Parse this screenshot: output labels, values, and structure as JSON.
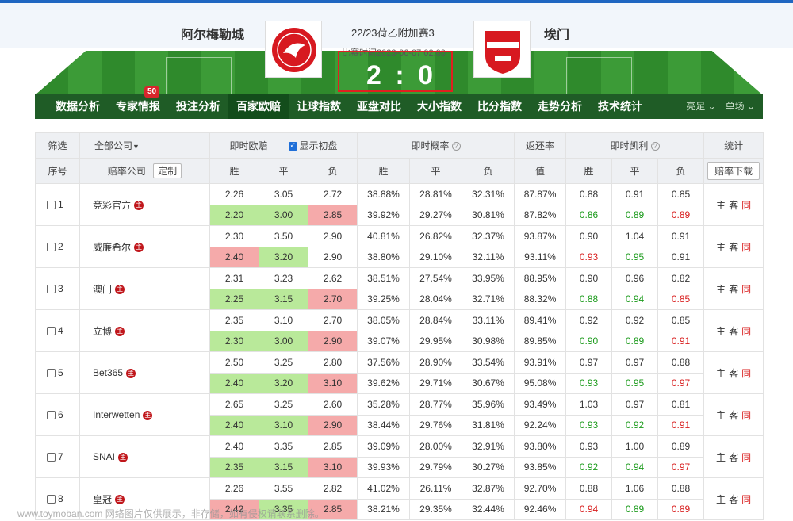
{
  "header": {
    "home_team": "阿尔梅勒城",
    "away_team": "埃门",
    "match_title": "22/23荷乙附加赛3",
    "match_time": "比赛时间2023-06-07 02:00",
    "score": "2 : 0"
  },
  "nav": {
    "items": [
      "数据分析",
      "专家情报",
      "投注分析",
      "百家欧赔",
      "让球指数",
      "亚盘对比",
      "大小指数",
      "比分指数",
      "走势分析",
      "技术统计"
    ],
    "badge": "50",
    "active_index": 3,
    "right_options": [
      "亮足 ⌄",
      "单场 ⌄"
    ]
  },
  "table_header": {
    "filter": "筛选",
    "all_companies": "全部公司",
    "live_euro": "即时欧赔",
    "show_initial": "显示初盘",
    "live_prob": "即时概率",
    "return_rate": "返还率",
    "live_kelly": "即时凯利",
    "stats": "统计",
    "seq": "序号",
    "company": "赔率公司",
    "customize": "定制",
    "win": "胜",
    "draw": "平",
    "lose": "负",
    "value": "值",
    "download": "赔率下载"
  },
  "stat_labels": {
    "home": "主",
    "away": "客",
    "same": "同"
  },
  "rows": [
    {
      "idx": "1",
      "name": "竞彩官方",
      "live": [
        "2.26",
        "3.05",
        "2.72"
      ],
      "init": [
        "2.20",
        "3.00",
        "2.85"
      ],
      "init_colors": [
        "g",
        "g",
        "r"
      ],
      "prob_live": [
        "38.88%",
        "28.81%",
        "32.31%"
      ],
      "prob_init": [
        "39.92%",
        "29.27%",
        "30.81%"
      ],
      "ret_live": "87.87%",
      "ret_init": "87.82%",
      "kelly_live": [
        "0.88",
        "0.91",
        "0.85"
      ],
      "kelly_init": [
        "0.86",
        "0.89",
        "0.89"
      ],
      "kelly_colors": [
        "g",
        "g",
        "r"
      ]
    },
    {
      "idx": "2",
      "name": "威廉希尔",
      "live": [
        "2.30",
        "3.50",
        "2.90"
      ],
      "init": [
        "2.40",
        "3.20",
        "2.90"
      ],
      "init_colors": [
        "r",
        "g",
        ""
      ],
      "prob_live": [
        "40.81%",
        "26.82%",
        "32.37%"
      ],
      "prob_init": [
        "38.80%",
        "29.10%",
        "32.11%"
      ],
      "ret_live": "93.87%",
      "ret_init": "93.11%",
      "kelly_live": [
        "0.90",
        "1.04",
        "0.91"
      ],
      "kelly_init": [
        "0.93",
        "0.95",
        "0.91"
      ],
      "kelly_colors": [
        "r",
        "g",
        ""
      ]
    },
    {
      "idx": "3",
      "name": "澳门",
      "live": [
        "2.31",
        "3.23",
        "2.62"
      ],
      "init": [
        "2.25",
        "3.15",
        "2.70"
      ],
      "init_colors": [
        "g",
        "g",
        "r"
      ],
      "prob_live": [
        "38.51%",
        "27.54%",
        "33.95%"
      ],
      "prob_init": [
        "39.25%",
        "28.04%",
        "32.71%"
      ],
      "ret_live": "88.95%",
      "ret_init": "88.32%",
      "kelly_live": [
        "0.90",
        "0.96",
        "0.82"
      ],
      "kelly_init": [
        "0.88",
        "0.94",
        "0.85"
      ],
      "kelly_colors": [
        "g",
        "g",
        "r"
      ]
    },
    {
      "idx": "4",
      "name": "立博",
      "live": [
        "2.35",
        "3.10",
        "2.70"
      ],
      "init": [
        "2.30",
        "3.00",
        "2.90"
      ],
      "init_colors": [
        "g",
        "g",
        "r"
      ],
      "prob_live": [
        "38.05%",
        "28.84%",
        "33.11%"
      ],
      "prob_init": [
        "39.07%",
        "29.95%",
        "30.98%"
      ],
      "ret_live": "89.41%",
      "ret_init": "89.85%",
      "kelly_live": [
        "0.92",
        "0.92",
        "0.85"
      ],
      "kelly_init": [
        "0.90",
        "0.89",
        "0.91"
      ],
      "kelly_colors": [
        "g",
        "g",
        "r"
      ]
    },
    {
      "idx": "5",
      "name": "Bet365",
      "live": [
        "2.50",
        "3.25",
        "2.80"
      ],
      "init": [
        "2.40",
        "3.20",
        "3.10"
      ],
      "init_colors": [
        "g",
        "g",
        "r"
      ],
      "prob_live": [
        "37.56%",
        "28.90%",
        "33.54%"
      ],
      "prob_init": [
        "39.62%",
        "29.71%",
        "30.67%"
      ],
      "ret_live": "93.91%",
      "ret_init": "95.08%",
      "kelly_live": [
        "0.97",
        "0.97",
        "0.88"
      ],
      "kelly_init": [
        "0.93",
        "0.95",
        "0.97"
      ],
      "kelly_colors": [
        "g",
        "g",
        "r"
      ]
    },
    {
      "idx": "6",
      "name": "Interwetten",
      "live": [
        "2.65",
        "3.25",
        "2.60"
      ],
      "init": [
        "2.40",
        "3.10",
        "2.90"
      ],
      "init_colors": [
        "g",
        "g",
        "r"
      ],
      "prob_live": [
        "35.28%",
        "28.77%",
        "35.96%"
      ],
      "prob_init": [
        "38.44%",
        "29.76%",
        "31.81%"
      ],
      "ret_live": "93.49%",
      "ret_init": "92.24%",
      "kelly_live": [
        "1.03",
        "0.97",
        "0.81"
      ],
      "kelly_init": [
        "0.93",
        "0.92",
        "0.91"
      ],
      "kelly_colors": [
        "g",
        "g",
        "r"
      ]
    },
    {
      "idx": "7",
      "name": "SNAI",
      "live": [
        "2.40",
        "3.35",
        "2.85"
      ],
      "init": [
        "2.35",
        "3.15",
        "3.10"
      ],
      "init_colors": [
        "g",
        "g",
        "r"
      ],
      "prob_live": [
        "39.09%",
        "28.00%",
        "32.91%"
      ],
      "prob_init": [
        "39.93%",
        "29.79%",
        "30.27%"
      ],
      "ret_live": "93.80%",
      "ret_init": "93.85%",
      "kelly_live": [
        "0.93",
        "1.00",
        "0.89"
      ],
      "kelly_init": [
        "0.92",
        "0.94",
        "0.97"
      ],
      "kelly_colors": [
        "g",
        "g",
        "r"
      ]
    },
    {
      "idx": "8",
      "name": "皇冠",
      "live": [
        "2.26",
        "3.55",
        "2.82"
      ],
      "init": [
        "2.42",
        "3.35",
        "2.85"
      ],
      "init_colors": [
        "r",
        "g",
        "r"
      ],
      "prob_live": [
        "41.02%",
        "26.11%",
        "32.87%"
      ],
      "prob_init": [
        "38.21%",
        "29.35%",
        "32.44%"
      ],
      "ret_live": "92.70%",
      "ret_init": "92.46%",
      "kelly_live": [
        "0.88",
        "1.06",
        "0.88"
      ],
      "kelly_init": [
        "0.94",
        "0.89",
        "0.89"
      ],
      "kelly_colors": [
        "r",
        "g",
        "r"
      ]
    }
  ],
  "watermark": "www.toymoban.com 网络图片仅供展示，非存储，如有侵权请联系删除。",
  "colors": {
    "nav_bg": "#1f5c26",
    "green_cell": "#b9e99a",
    "red_cell": "#f5aaaa",
    "score_box": "#e02020"
  }
}
